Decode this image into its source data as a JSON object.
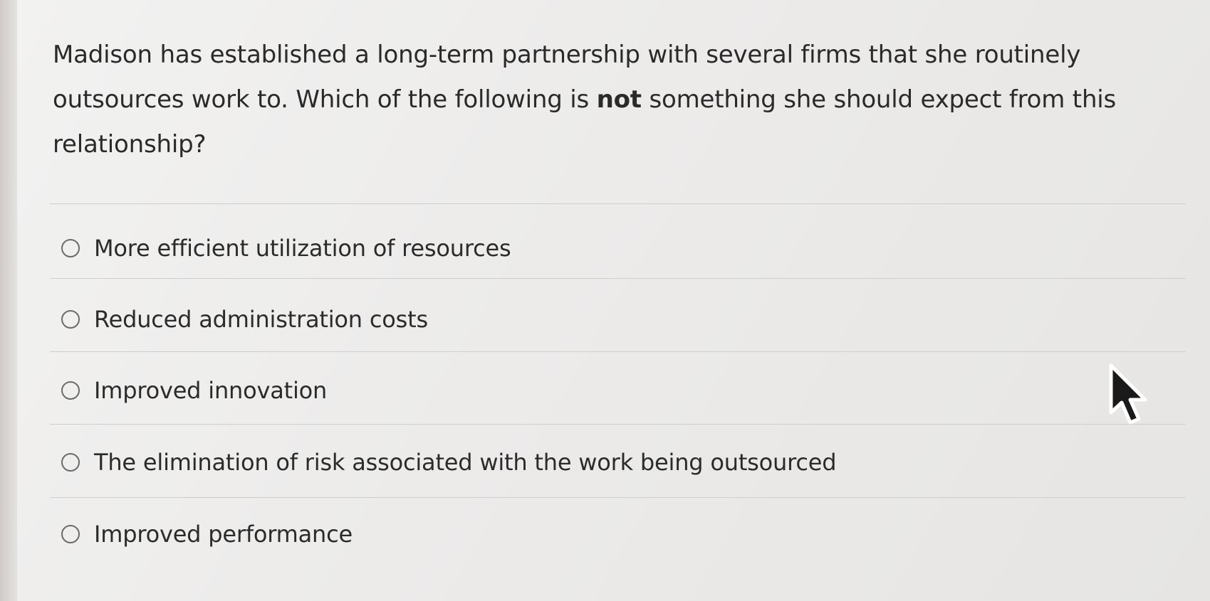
{
  "question": {
    "line1": "Madison has established a long-term partnership with several firms that she routinely",
    "line2_pre": "outsources work to.  Which of the following is ",
    "line2_bold": "not",
    "line2_post": " something she should expect from this",
    "line3": "relationship?"
  },
  "options": [
    {
      "label": "More efficient utilization of resources",
      "selected": false
    },
    {
      "label": "Reduced administration costs",
      "selected": false
    },
    {
      "label": "Improved innovation",
      "selected": false
    },
    {
      "label": "The elimination of risk associated with the work being outsourced",
      "selected": false
    },
    {
      "label": "Improved performance",
      "selected": false
    }
  ],
  "icons": {
    "cursor": "mouse-pointer-icon",
    "radio": "radio-button-icon"
  }
}
